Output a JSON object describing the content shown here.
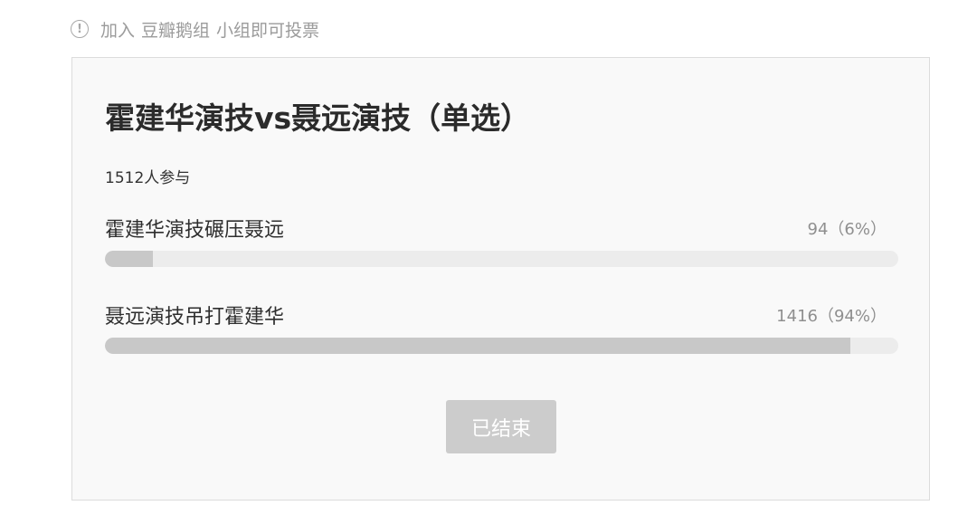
{
  "notice": {
    "icon": "exclamation-circle-icon",
    "join_text": "加入",
    "group_name": "豆瓣鹅组",
    "suffix_text": "小组即可投票"
  },
  "poll": {
    "title": "霍建华演技vs聂远演技（单选）",
    "participants": "1512人参与",
    "options": [
      {
        "label": "霍建华演技碾压聂远",
        "count_text": "94（6%）",
        "percent": 6
      },
      {
        "label": "聂远演技吊打霍建华",
        "count_text": "1416（94%）",
        "percent": 94
      }
    ],
    "status_button": "已结束"
  }
}
